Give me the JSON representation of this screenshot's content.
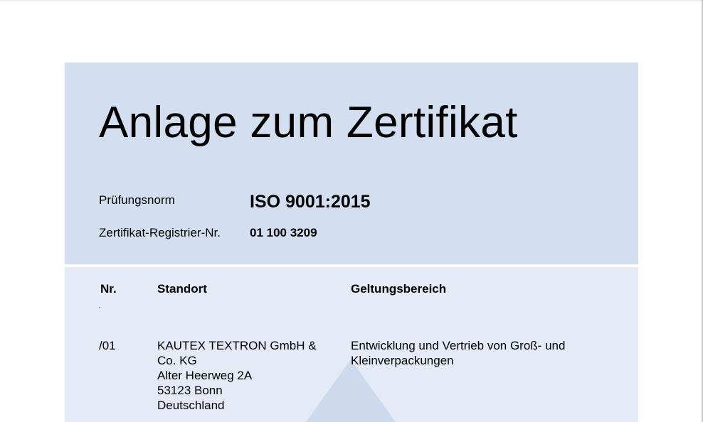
{
  "document": {
    "title": "Anlage zum Zertifikat",
    "norm": {
      "label": "Prüfungsnorm",
      "value": "ISO 9001:2015"
    },
    "registration": {
      "label": "Zertifikat-Registrier-Nr.",
      "value": "01 100 3209"
    }
  },
  "table": {
    "headers": {
      "nr": "Nr.",
      "standort": "Standort",
      "geltungsbereich": "Geltungsbereich"
    },
    "rows": [
      {
        "nr": "/01",
        "standort": [
          "KAUTEX TEXTRON GmbH &",
          "Co. KG",
          "Alter Heerweg 2A",
          "53123 Bonn",
          "Deutschland"
        ],
        "geltungsbereich": [
          "Entwicklung und Vertrieb von Groß- und",
          "Kleinverpackungen"
        ]
      }
    ]
  },
  "colors": {
    "header_background": "#d3dff0",
    "table_background": "#e4eaf6",
    "watermark": "#cdd9ec"
  }
}
